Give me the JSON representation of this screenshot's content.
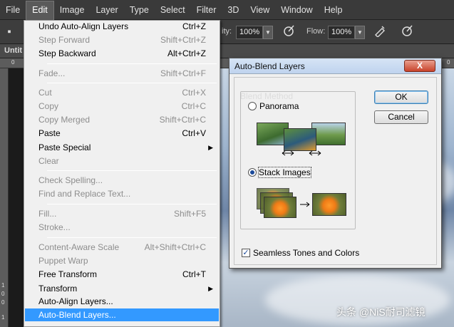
{
  "menubar": {
    "items": [
      "File",
      "Edit",
      "Image",
      "Layer",
      "Type",
      "Select",
      "Filter",
      "3D",
      "View",
      "Window",
      "Help"
    ],
    "active": "Edit"
  },
  "options_bar": {
    "opacity_label": "ity:",
    "opacity_value": "100%",
    "flow_label": "Flow:",
    "flow_value": "100%"
  },
  "document": {
    "tab_title": "Untit"
  },
  "rulers": {
    "top_marks": [
      "0",
      "0"
    ],
    "left_marks": [
      "1",
      "0",
      "0",
      "1"
    ]
  },
  "edit_menu": {
    "items": [
      {
        "label": "Undo Auto-Align Layers",
        "shortcut": "Ctrl+Z",
        "enabled": true
      },
      {
        "label": "Step Forward",
        "shortcut": "Shift+Ctrl+Z",
        "enabled": false
      },
      {
        "label": "Step Backward",
        "shortcut": "Alt+Ctrl+Z",
        "enabled": true
      },
      {
        "label": "Fade...",
        "shortcut": "Shift+Ctrl+F",
        "enabled": false
      },
      {
        "label": "Cut",
        "shortcut": "Ctrl+X",
        "enabled": false
      },
      {
        "label": "Copy",
        "shortcut": "Ctrl+C",
        "enabled": false
      },
      {
        "label": "Copy Merged",
        "shortcut": "Shift+Ctrl+C",
        "enabled": false
      },
      {
        "label": "Paste",
        "shortcut": "Ctrl+V",
        "enabled": true
      },
      {
        "label": "Paste Special",
        "shortcut": "",
        "enabled": true,
        "submenu": true
      },
      {
        "label": "Clear",
        "shortcut": "",
        "enabled": false
      },
      {
        "label": "Check Spelling...",
        "shortcut": "",
        "enabled": false
      },
      {
        "label": "Find and Replace Text...",
        "shortcut": "",
        "enabled": false
      },
      {
        "label": "Fill...",
        "shortcut": "Shift+F5",
        "enabled": false
      },
      {
        "label": "Stroke...",
        "shortcut": "",
        "enabled": false
      },
      {
        "label": "Content-Aware Scale",
        "shortcut": "Alt+Shift+Ctrl+C",
        "enabled": false
      },
      {
        "label": "Puppet Warp",
        "shortcut": "",
        "enabled": false
      },
      {
        "label": "Free Transform",
        "shortcut": "Ctrl+T",
        "enabled": true
      },
      {
        "label": "Transform",
        "shortcut": "",
        "enabled": true,
        "submenu": true
      },
      {
        "label": "Auto-Align Layers...",
        "shortcut": "",
        "enabled": true
      },
      {
        "label": "Auto-Blend Layers...",
        "shortcut": "",
        "enabled": true,
        "highlighted": true
      }
    ]
  },
  "dialog": {
    "title": "Auto-Blend Layers",
    "close_label": "X",
    "group_label": "Blend Method",
    "option_panorama": "Panorama",
    "option_stack": "Stack Images",
    "selected_option": "Stack Images",
    "seamless_label": "Seamless Tones and Colors",
    "seamless_checked": true,
    "ok_label": "OK",
    "cancel_label": "Cancel",
    "check_mark": "✓"
  },
  "watermark": "头条 @NiS耐司滤镜",
  "colors": {
    "menu_highlight": "#3399ff",
    "dialog_close": "#c8432b"
  }
}
